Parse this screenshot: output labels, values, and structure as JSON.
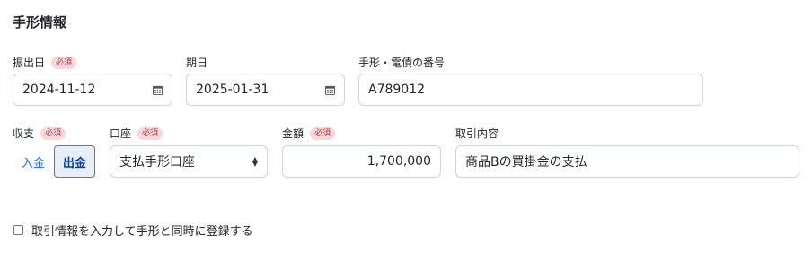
{
  "section": {
    "title": "手形情報"
  },
  "required_badge": "必須",
  "issue_date": {
    "label": "振出日",
    "value": "2024-11-12"
  },
  "due_date": {
    "label": "期日",
    "value": "2025-01-31"
  },
  "note_number": {
    "label": "手形・電債の番号",
    "value": "A789012"
  },
  "direction": {
    "label": "収支",
    "options": [
      "入金",
      "出金"
    ],
    "selected": "出金"
  },
  "account": {
    "label": "口座",
    "value": "支払手形口座"
  },
  "amount": {
    "label": "金額",
    "value": "1,700,000"
  },
  "transaction": {
    "label": "取引内容",
    "value": "商品Bの買掛金の支払"
  },
  "register_checkbox": {
    "label": "取引情報を入力して手形と同時に登録する",
    "checked": false
  }
}
